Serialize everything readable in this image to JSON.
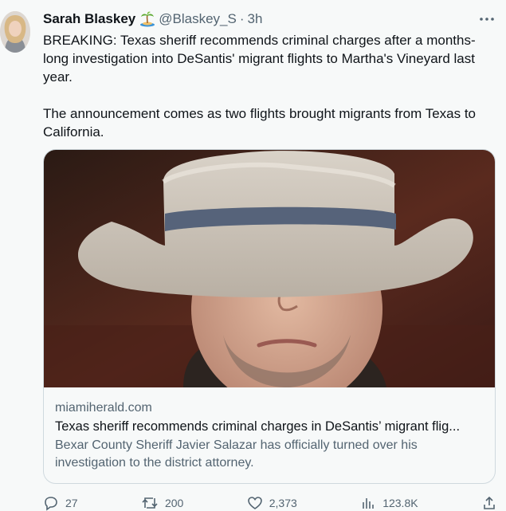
{
  "tweet": {
    "author_name": "Sarah Blaskey",
    "author_emoji": "island-with-palm-tree",
    "handle": "@Blaskey_S",
    "separator": "·",
    "time": "3h",
    "paragraph_1": "BREAKING: Texas sheriff recommends criminal charges after a months-long investigation into DeSantis' migrant flights to Martha's Vineyard last year.",
    "paragraph_2": "The announcement comes as two flights brought migrants from Texas to California."
  },
  "card": {
    "domain": "miamiherald.com",
    "title": "Texas sheriff recommends criminal charges in DeSantis’ migrant flig...",
    "description": "Bexar County Sheriff Javier Salazar has officially turned over his investigation to the district attorney."
  },
  "actions": {
    "replies": "27",
    "retweets": "200",
    "likes": "2,373",
    "views": "123.8K"
  },
  "icons": {
    "more": "more-horizontal-icon",
    "reply": "reply-icon",
    "retweet": "retweet-icon",
    "like": "heart-icon",
    "views": "views-icon",
    "share": "share-icon"
  },
  "colors": {
    "background": "#f7f9f9",
    "text": "#0f1419",
    "secondary": "#536471",
    "border": "#cfd9de"
  }
}
